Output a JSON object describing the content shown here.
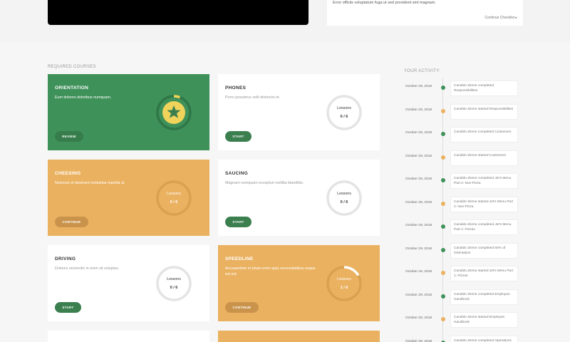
{
  "top": {
    "checklist_desc": "Error officiis voluptatum fuga ut sed provident sint magnam.",
    "checklist_link": "Continue Checklist"
  },
  "sections": {
    "required_courses": "REQUIRED COURSES",
    "your_activity": "YOUR ACTIVITY:"
  },
  "courses": [
    {
      "title": "ORIENTATION",
      "desc": "Eum dolores doloribus numquam.",
      "button": "REVIEW",
      "style": "green",
      "progress": 1.0,
      "lessons_label": "",
      "count": ""
    },
    {
      "title": "PHONES",
      "desc": "Porro possimus velit distinctio et.",
      "button": "START",
      "style": "white",
      "progress": 0.0,
      "lessons_label": "Lessons",
      "count": "0 / 6"
    },
    {
      "title": "CHEESING",
      "desc": "Nesciunt et deserunt molestias repellat ut.",
      "button": "CONTINUE",
      "style": "orange",
      "progress": 0.0,
      "lessons_label": "Lessons",
      "count": "0 / 6"
    },
    {
      "title": "SAUCING",
      "desc": "Magnam numquam excepturi mollitia blanditiis.",
      "button": "START",
      "style": "white",
      "progress": 0.0,
      "lessons_label": "Lessons",
      "count": "0 / 6"
    },
    {
      "title": "DRIVING",
      "desc": "Dolores reiciendis in enim sit voluptas.",
      "button": "START",
      "style": "white",
      "progress": 0.0,
      "lessons_label": "Lessons",
      "count": "0 / 6"
    },
    {
      "title": "SPEEDLINE",
      "desc": "Accusantium et totam enim quia necessitatibus eaque est est.",
      "button": "CONTINUE",
      "style": "orange",
      "progress": 0.1667,
      "lessons_label": "Lessons",
      "count": "1 / 6"
    }
  ],
  "activity": [
    {
      "date": "October 29, 2018",
      "text": "Candido Zieme completed Responsibilities",
      "status": "green"
    },
    {
      "date": "October 29, 2018",
      "text": "Candido Zieme started Responsibilities",
      "status": "orange"
    },
    {
      "date": "October 29, 2018",
      "text": "Candido Zieme completed Customers",
      "status": "green"
    },
    {
      "date": "October 29, 2018",
      "text": "Candido Zieme started Customers",
      "status": "orange"
    },
    {
      "date": "October 29, 2018",
      "text": "Candido Zieme completed Jet's Menu Part 2: Non-Pizza",
      "status": "green"
    },
    {
      "date": "October 29, 2018",
      "text": "Candido Zieme started Jet's Menu Part 2: Non-Pizza",
      "status": "orange"
    },
    {
      "date": "October 29, 2018",
      "text": "Candido Zieme completed Jet's Menu Part 1: Pizzas",
      "status": "green"
    },
    {
      "date": "October 29, 2018",
      "text": "Candido Zieme completed 50% of Orientation",
      "status": "green"
    },
    {
      "date": "October 29, 2018",
      "text": "Candido Zieme started Jet's Menu Part 1: Pizzas",
      "status": "orange"
    },
    {
      "date": "October 29, 2018",
      "text": "Candido Zieme completed Employee Handbook",
      "status": "green"
    },
    {
      "date": "October 29, 2018",
      "text": "Candido Zieme started Employee Handbook",
      "status": "orange"
    },
    {
      "date": "October 29, 2018",
      "text": "Candido Zieme completed Operations",
      "status": "green"
    }
  ],
  "colors": {
    "green": "#3f915a",
    "orange": "#eab160",
    "ring_track": "#e4e4e4",
    "star_badge": "#f0d35a"
  },
  "icons": {
    "play": "chevron-right-icon",
    "badge": "star-icon"
  }
}
